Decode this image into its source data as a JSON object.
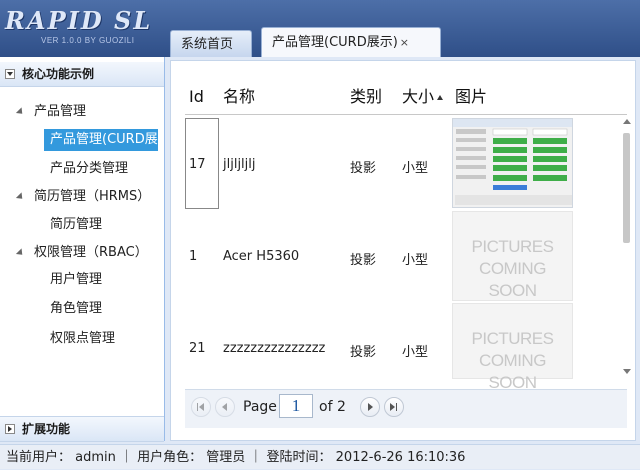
{
  "app": {
    "logo_text": "RAPID SL",
    "logo_subtitle": "VER 1.0.0 BY GUOZILI"
  },
  "tabs": [
    {
      "label": "系统首页",
      "active": false
    },
    {
      "label": "产品管理(CURD展示)",
      "active": true,
      "close_icon": "×"
    }
  ],
  "sidebar": {
    "sections": [
      {
        "label": "核心功能示例",
        "expanded": true
      },
      {
        "label": "扩展功能",
        "expanded": false
      }
    ],
    "tree": [
      {
        "label": "产品管理",
        "level": 0,
        "expanded": true
      },
      {
        "label": "产品管理(CURD展示)",
        "level": 1,
        "selected": true
      },
      {
        "label": "产品分类管理",
        "level": 1
      },
      {
        "label": "简历管理（HRMS）",
        "level": 0,
        "expanded": true
      },
      {
        "label": "简历管理",
        "level": 1
      },
      {
        "label": "权限管理（RBAC）",
        "level": 0,
        "expanded": true
      },
      {
        "label": "用户管理",
        "level": 1
      },
      {
        "label": "角色管理",
        "level": 1
      },
      {
        "label": "权限点管理",
        "level": 1
      }
    ]
  },
  "grid": {
    "columns": [
      {
        "label": "Id"
      },
      {
        "label": "名称"
      },
      {
        "label": "类别"
      },
      {
        "label": "大小",
        "sorted": "asc"
      },
      {
        "label": "图片"
      }
    ],
    "rows": [
      {
        "id": "17",
        "name": "jljljljlj",
        "category": "投影",
        "size": "小型",
        "image": "screenshot"
      },
      {
        "id": "1",
        "name": "Acer H5360",
        "category": "投影",
        "size": "小型",
        "image": "placeholder"
      },
      {
        "id": "21",
        "name": "zzzzzzzzzzzzzzz",
        "category": "投影",
        "size": "小型",
        "image": "placeholder"
      }
    ],
    "placeholder_text": [
      "PICTURES",
      "COMING SOON"
    ]
  },
  "pager": {
    "page_label": "Page",
    "current_page": "1",
    "of_label": "of 2"
  },
  "status": {
    "text": "当前用户： admin ｜ 用户角色： 管理员 ｜ 登陆时间： 2012-6-26 16:10:36"
  },
  "colors": {
    "header": "#3a5d98",
    "selected": "#3399dd",
    "panel_border": "#99bbe8"
  }
}
